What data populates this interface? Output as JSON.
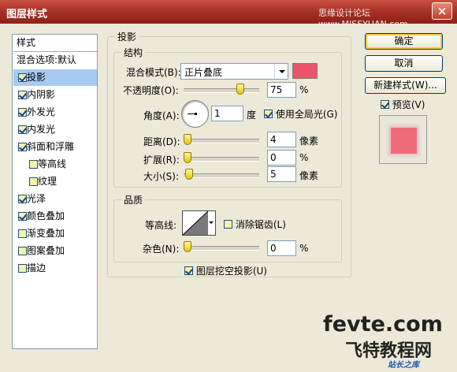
{
  "window": {
    "title": "图层样式",
    "watermark_top": "思缘设计论坛 www.MISSYUAN.com",
    "close_glyph": "×"
  },
  "left_panel": {
    "header": "样式",
    "items": [
      {
        "label": "混合选项:默认",
        "checkbox": false,
        "checked": false,
        "selected": false,
        "indent": false
      },
      {
        "label": "投影",
        "checkbox": true,
        "checked": true,
        "selected": true,
        "indent": false
      },
      {
        "label": "内阴影",
        "checkbox": true,
        "checked": true,
        "selected": false,
        "indent": false
      },
      {
        "label": "外发光",
        "checkbox": true,
        "checked": true,
        "selected": false,
        "indent": false
      },
      {
        "label": "内发光",
        "checkbox": true,
        "checked": true,
        "selected": false,
        "indent": false
      },
      {
        "label": "斜面和浮雕",
        "checkbox": true,
        "checked": true,
        "selected": false,
        "indent": false
      },
      {
        "label": "等高线",
        "checkbox": true,
        "checked": false,
        "selected": false,
        "indent": true
      },
      {
        "label": "纹理",
        "checkbox": true,
        "checked": false,
        "selected": false,
        "indent": true
      },
      {
        "label": "光泽",
        "checkbox": true,
        "checked": true,
        "selected": false,
        "indent": false
      },
      {
        "label": "颜色叠加",
        "checkbox": true,
        "checked": true,
        "selected": false,
        "indent": false
      },
      {
        "label": "渐变叠加",
        "checkbox": true,
        "checked": false,
        "selected": false,
        "indent": false
      },
      {
        "label": "图案叠加",
        "checkbox": true,
        "checked": false,
        "selected": false,
        "indent": false
      },
      {
        "label": "描边",
        "checkbox": true,
        "checked": false,
        "selected": false,
        "indent": false
      }
    ]
  },
  "shadow": {
    "group_title": "投影",
    "structure_title": "结构",
    "blend_mode_label": "混合模式(B):",
    "blend_mode_value": "正片叠底",
    "shadow_color": "#e8556a",
    "opacity_label": "不透明度(O):",
    "opacity_value": "75",
    "opacity_fraction": 0.75,
    "percent": "%",
    "angle_label": "角度(A):",
    "angle_value": "1",
    "angle_unit": "度",
    "global_light_label": "使用全局光(G)",
    "global_light_checked": true,
    "distance_label": "距离(D):",
    "distance_value": "4",
    "px_unit": "像素",
    "spread_label": "扩展(R):",
    "spread_value": "0",
    "size_label": "大小(S):",
    "size_value": "5",
    "quality_title": "品质",
    "contour_label": "等高线:",
    "anti_alias_label": "消除锯齿(L)",
    "anti_alias_checked": false,
    "noise_label": "杂色(N):",
    "noise_value": "0",
    "knockout_label": "图层挖空投影(U)",
    "knockout_checked": true
  },
  "buttons": {
    "ok": "确定",
    "cancel": "取消",
    "new_style": "新建样式(W)...",
    "preview_label": "预览(V)",
    "preview_checked": true
  },
  "watermark": {
    "site": "fevte.com",
    "cn": "飞特教程网",
    "small": "站长之库"
  }
}
